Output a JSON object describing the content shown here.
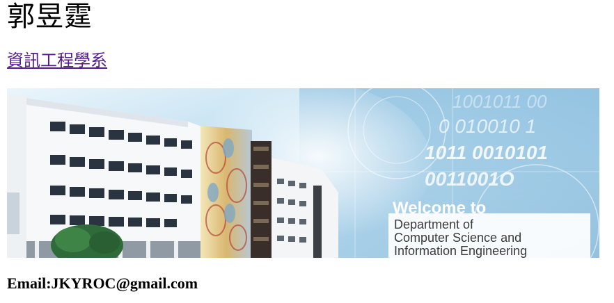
{
  "header": {
    "name": "郭昱霆",
    "department_link": "資訊工程學系"
  },
  "banner": {
    "welcome": "Welcome to",
    "line1": "Department of",
    "line2": "Computer Science and",
    "line3": "Information Engineering",
    "binary1": "1001011 00",
    "binary2": "0 010010 1",
    "binary3": "1011 0010101",
    "binary4": "0011001O"
  },
  "contact": {
    "email": "Email:JKYROC@gmail.com"
  },
  "colors": {
    "link": "#551a8b",
    "sky_light": "#d8ecf6",
    "sky_mid": "#9cc8e4",
    "accent_blue": "#2b6fae"
  }
}
